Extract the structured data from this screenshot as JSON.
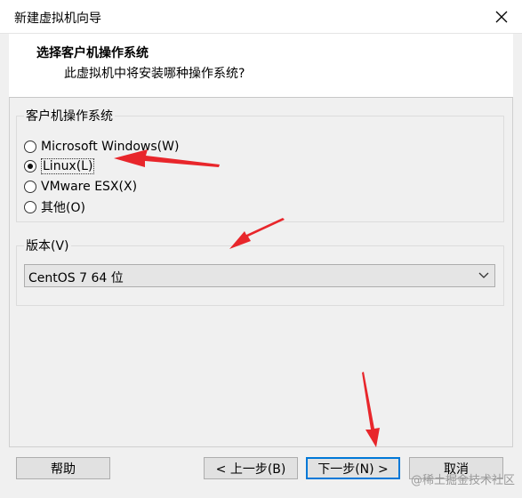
{
  "window": {
    "title": "新建虚拟机向导",
    "close_icon": "close-icon"
  },
  "header": {
    "title": "选择客户机操作系统",
    "subtitle": "此虚拟机中将安装哪种操作系统?"
  },
  "guest_os": {
    "legend": "客户机操作系统",
    "options": [
      {
        "label": "Microsoft Windows(W)",
        "checked": false
      },
      {
        "label": "Linux(L)",
        "checked": true
      },
      {
        "label": "VMware ESX(X)",
        "checked": false
      },
      {
        "label": "其他(O)",
        "checked": false
      }
    ]
  },
  "version": {
    "legend": "版本(V)",
    "selected": "CentOS 7 64 位"
  },
  "buttons": {
    "help": "帮助",
    "back": "< 上一步(B)",
    "next": "下一步(N) >",
    "cancel": "取消"
  },
  "watermark": "@稀土掘金技术社区",
  "colors": {
    "annotation_arrow": "#e8262b",
    "focus_border": "#0078d7"
  }
}
